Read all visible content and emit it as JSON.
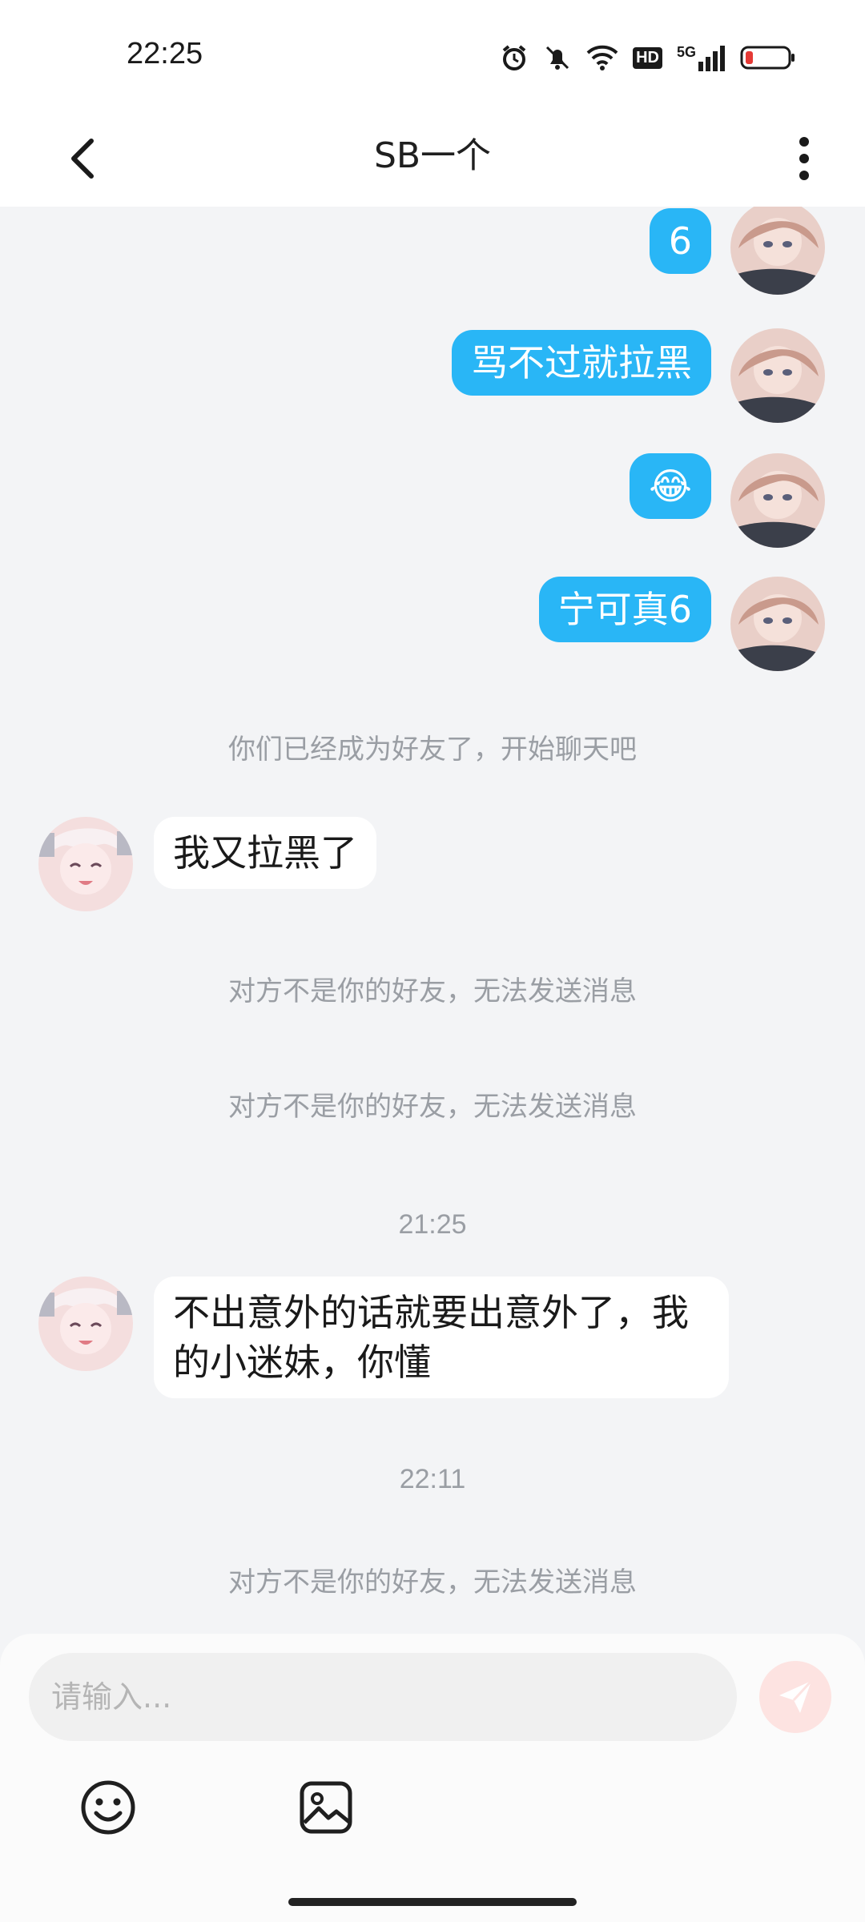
{
  "status_bar": {
    "time": "22:25",
    "icons": [
      "alarm-icon",
      "mute-icon",
      "wifi-icon",
      "hd-icon",
      "signal-5g-icon",
      "battery-low-icon"
    ],
    "hd_label": "HD",
    "network_label": "5G"
  },
  "nav": {
    "title": "SB一个",
    "back_icon": "chevron-left-icon",
    "more_icon": "more-vertical-icon"
  },
  "messages": {
    "out_1": "6",
    "out_2": "骂不过就拉黑",
    "out_3": "😂",
    "out_4": "宁可真6",
    "sys_1": "你们已经成为好友了，开始聊天吧",
    "in_1": "我又拉黑了",
    "sys_2": "对方不是你的好友，无法发送消息",
    "sys_3": "对方不是你的好友，无法发送消息",
    "time_1": "21:25",
    "in_2_line1": "不出意外的话就要出意外了，我",
    "in_2_line2": "的小迷妹，你懂",
    "time_2": "22:11",
    "sys_4": "对方不是你的好友，无法发送消息"
  },
  "input": {
    "placeholder": "请输入..."
  },
  "colors": {
    "outgoing_bubble": "#29b6f6",
    "incoming_bubble": "#ffffff",
    "system_text": "#9a9ea4",
    "send_button": "#fde3e1"
  }
}
